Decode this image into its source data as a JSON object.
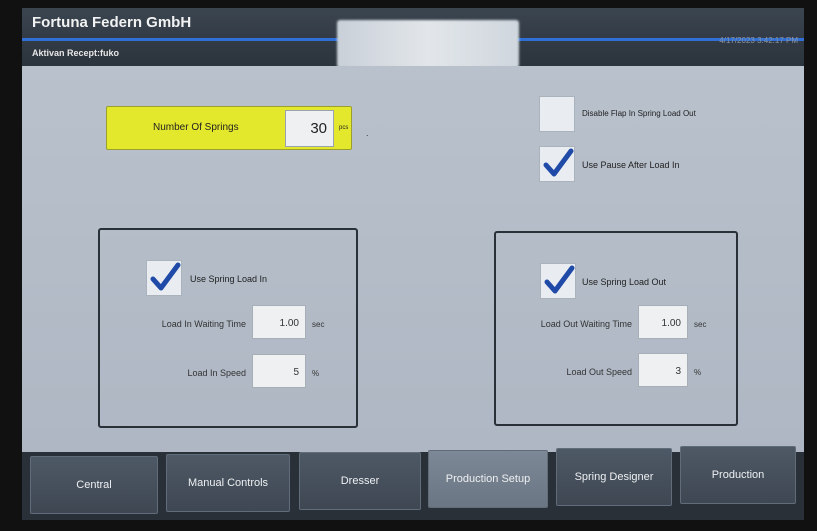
{
  "header": {
    "company": "Fortuna Federn GmbH",
    "recipe": "Aktivan Recept:fuko",
    "datetime": "4/17/2023 3:42:17 PM"
  },
  "springs": {
    "label": "Number Of Springs",
    "value": "30",
    "unit": "pcs"
  },
  "options": {
    "disable_flap": {
      "label": "Disable Flap In Spring Load Out",
      "checked": false
    },
    "use_pause": {
      "label": "Use Pause After Load In",
      "checked": true
    }
  },
  "load_in": {
    "enable_label": "Use Spring Load In",
    "checked": true,
    "waiting_label": "Load In Waiting Time",
    "waiting_value": "1.00",
    "waiting_unit": "sec",
    "speed_label": "Load In Speed",
    "speed_value": "5",
    "speed_unit": "%"
  },
  "load_out": {
    "enable_label": "Use Spring Load Out",
    "checked": true,
    "waiting_label": "Load Out Waiting Time",
    "waiting_value": "1.00",
    "waiting_unit": "sec",
    "speed_label": "Load Out Speed",
    "speed_value": "3",
    "speed_unit": "%"
  },
  "nav": {
    "items": [
      {
        "label": "Central"
      },
      {
        "label": "Manual Controls"
      },
      {
        "label": "Dresser"
      },
      {
        "label": "Production Setup",
        "active": true
      },
      {
        "label": "Spring Designer"
      },
      {
        "label": "Production"
      }
    ]
  },
  "colors": {
    "accent": "#2f6fd6",
    "highlight": "#e4e82c",
    "check": "#1f4aa8"
  },
  "icons": {
    "check": "checkmark-icon"
  }
}
